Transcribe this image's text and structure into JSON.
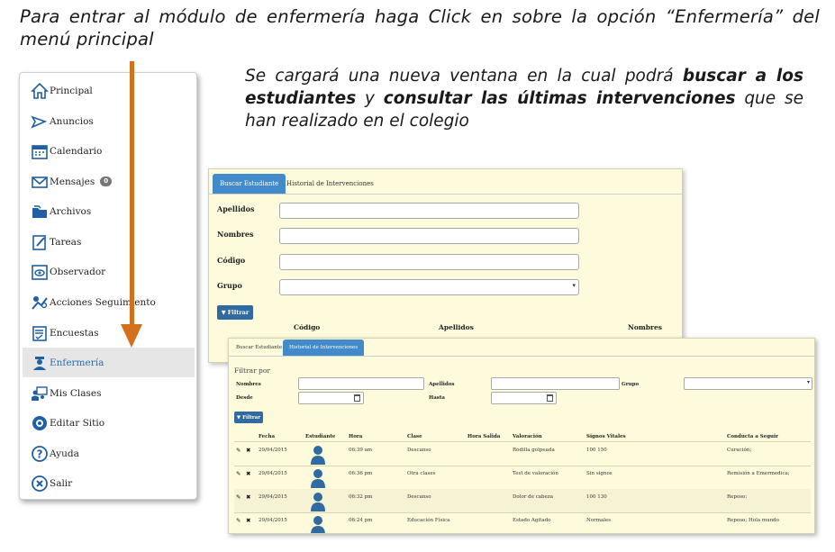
{
  "instructions": {
    "top": "Para entrar al módulo de enfermería haga Click en sobre la opción “Enfermería” del menú principal",
    "right_pre": "Se cargará una nueva ventana en la cual podrá ",
    "right_bold1": "buscar a los estudiantes",
    "right_mid": " y ",
    "right_bold2": "consultar las últimas intervenciones",
    "right_post": " que se han realizado en el colegio"
  },
  "menu": {
    "items": [
      {
        "label": "Principal",
        "icon": "home-icon"
      },
      {
        "label": "Anuncios",
        "icon": "megaphone-icon"
      },
      {
        "label": "Calendario",
        "icon": "calendar-icon"
      },
      {
        "label": "Mensajes",
        "icon": "envelope-icon",
        "badge": "0"
      },
      {
        "label": "Archivos",
        "icon": "folder-icon"
      },
      {
        "label": "Tareas",
        "icon": "tasks-icon"
      },
      {
        "label": "Observador",
        "icon": "observer-icon"
      },
      {
        "label": "Acciones Seguimiento",
        "icon": "tracking-icon"
      },
      {
        "label": "Encuestas",
        "icon": "survey-icon"
      },
      {
        "label": "Enfermería",
        "icon": "nurse-icon",
        "active": true
      },
      {
        "label": "Mis Clases",
        "icon": "classes-icon"
      },
      {
        "label": "Editar Sitio",
        "icon": "edit-site-icon"
      },
      {
        "label": "Ayuda",
        "icon": "help-icon"
      },
      {
        "label": "Salir",
        "icon": "exit-icon"
      }
    ]
  },
  "search_panel": {
    "tabs": [
      "Buscar Estudiante",
      "Historial de Intervenciones"
    ],
    "fields": {
      "apellidos": "Apellidos",
      "nombres": "Nombres",
      "codigo": "Código",
      "grupo": "Grupo"
    },
    "filter_button": "Filtrar",
    "columns": [
      "Código",
      "Apellidos",
      "Nombres"
    ]
  },
  "history_panel": {
    "tabs": [
      "Buscar Estudiante",
      "Historial de Intervenciones"
    ],
    "filter_title": "Filtrar por",
    "fields": {
      "nombres": "Nombres",
      "apellidos": "Apellidos",
      "grupo": "Grupo",
      "desde": "Desde",
      "hasta": "Hasta"
    },
    "filter_button": "Filtrar",
    "columns": [
      "Fecha",
      "Estudiante",
      "Hora",
      "Clase",
      "Hora Salida",
      "Valoración",
      "Signos Vitales",
      "Conducta a Seguir"
    ],
    "rows": [
      {
        "fecha": "29/04/2015",
        "hora": "06:39 am",
        "clase": "Descanso",
        "hora_salida": "",
        "valoracion": "Rodilla golpeada",
        "signos": "100 150",
        "conducta": "Curación;"
      },
      {
        "fecha": "29/04/2015",
        "hora": "06:36 pm",
        "clase": "Otra clases",
        "hora_salida": "",
        "valoracion": "Test de valoración",
        "signos": "Sin signos",
        "conducta": "Remisión a Emermedica;"
      },
      {
        "fecha": "29/04/2015",
        "hora": "06:32 pm",
        "clase": "Descanso",
        "hora_salida": "",
        "valoracion": "Dolor de cabeza",
        "signos": "100 130",
        "conducta": "Reposo;"
      },
      {
        "fecha": "29/04/2015",
        "hora": "06:24 pm",
        "clase": "Educación Física",
        "hora_salida": "",
        "valoracion": "Estado Agitado",
        "signos": "Normales",
        "conducta": "Reposo; Hola mundo"
      }
    ]
  },
  "colors": {
    "accent": "#428bca",
    "arrow": "#d4701c",
    "panel_bg": "#fdfbdb"
  }
}
